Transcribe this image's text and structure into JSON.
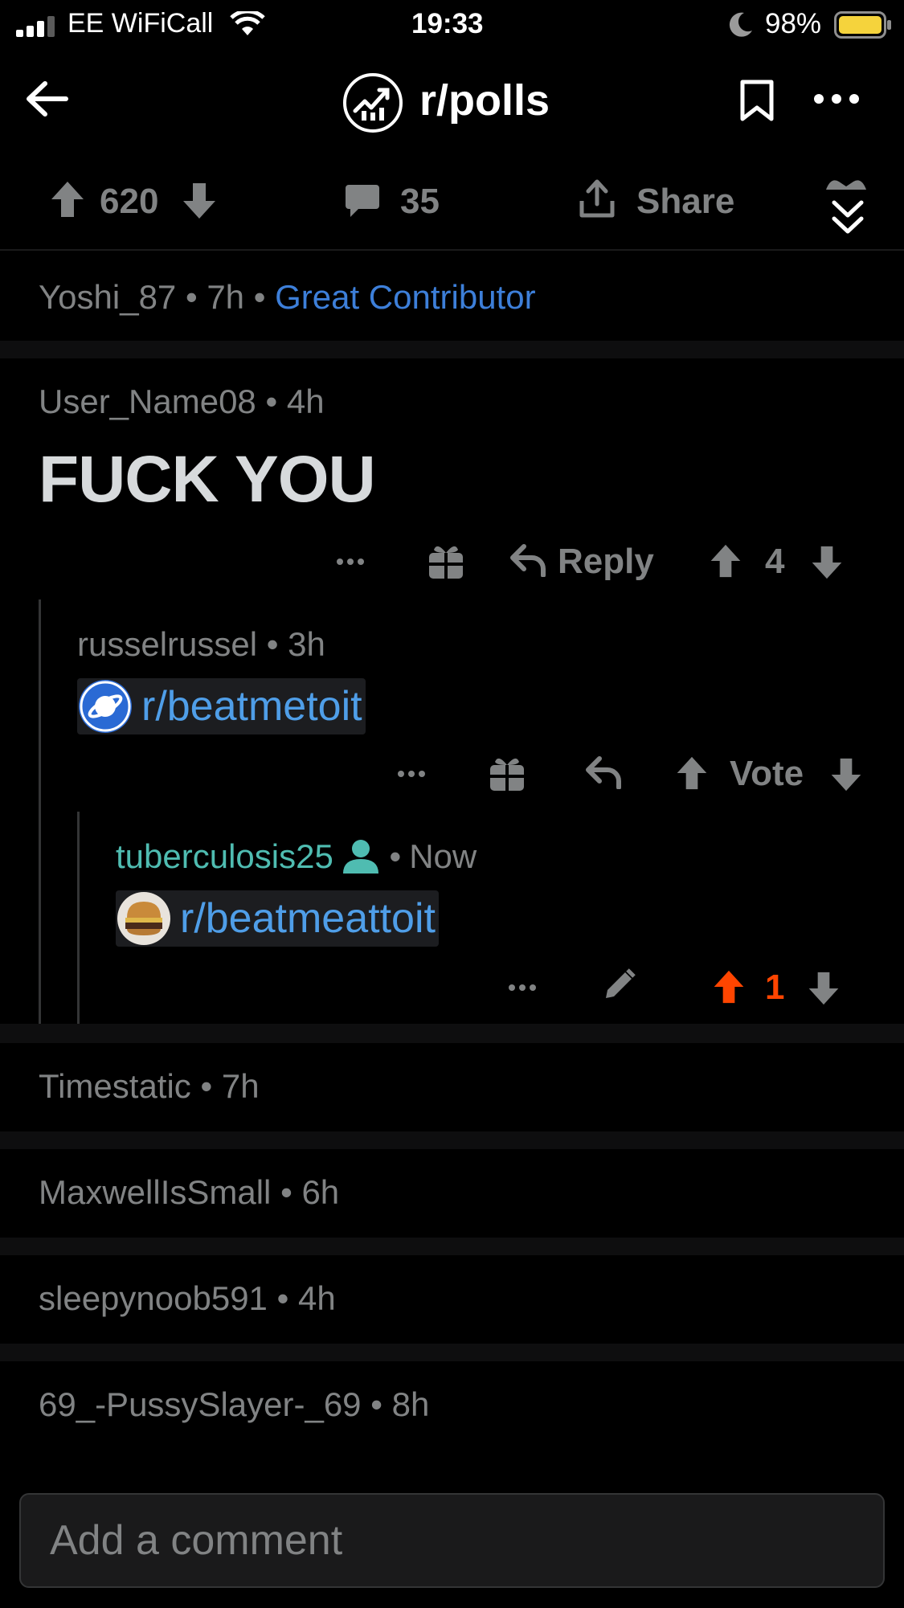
{
  "status_bar": {
    "carrier": "EE WiFiCall",
    "time": "19:33",
    "battery": "98%"
  },
  "header": {
    "subreddit": "r/polls"
  },
  "action_bar": {
    "vote_count": "620",
    "comment_count": "35",
    "share_label": "Share"
  },
  "collapsed_top": {
    "author": "Yoshi_87",
    "time": "7h",
    "flair": "Great Contributor"
  },
  "comment_main": {
    "author": "User_Name08",
    "time": "4h",
    "body": "FUCK YOU",
    "reply_label": "Reply",
    "score": "4"
  },
  "comment_reply1": {
    "author": "russelrussel",
    "time": "3h",
    "link": "r/beatmetoit",
    "vote_label": "Vote"
  },
  "comment_reply2": {
    "author": "tuberculosis25",
    "time": "Now",
    "link": "r/beatmeattoit",
    "score": "1"
  },
  "collapsed_comments": [
    {
      "author": "Timestatic",
      "time": "7h"
    },
    {
      "author": "MaxwellIsSmall",
      "time": "6h"
    },
    {
      "author": "sleepynoob591",
      "time": "4h"
    },
    {
      "author": "69_-PussySlayer-_69",
      "time": "8h"
    }
  ],
  "composer": {
    "placeholder": "Add a comment"
  },
  "colors": {
    "background": "#000000",
    "text": "#d7dadc",
    "muted": "#818384",
    "link": "#4f9ee8",
    "flair": "#3d7fd9",
    "op_green": "#4fbcb1",
    "upvote_orange": "#ff4500",
    "battery_yellow": "#f5d33c"
  },
  "icons": [
    "signal-icon",
    "wifi-icon",
    "moon-icon",
    "battery-icon",
    "back-arrow-icon",
    "subreddit-icon",
    "bookmark-icon",
    "more-icon",
    "upvote-icon",
    "downvote-icon",
    "comment-icon",
    "share-icon",
    "award-icon",
    "collapse-icon",
    "gift-icon",
    "reply-icon",
    "edit-icon",
    "user-icon",
    "planet-icon",
    "burger-avatar-icon"
  ]
}
